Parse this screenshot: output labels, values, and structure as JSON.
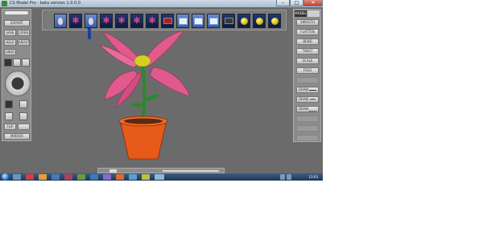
{
  "window": {
    "title": "CS Model Pro - beta version 1.0.0.0",
    "controls": {
      "minimize": "–",
      "maximize": "□",
      "close": "✕"
    }
  },
  "left_panel": {
    "top_slider_label": "",
    "buttons": [
      {
        "label": "EXPORT"
      },
      {
        "label": "SAVE"
      },
      {
        "label": "OPEN"
      },
      {
        "label": "HELP"
      },
      {
        "label": "ABOUT"
      },
      {
        "label": "UNDO"
      }
    ],
    "bottom_button": "MIRROR",
    "flip_button": "FLIP"
  },
  "toolbar": {
    "tools": [
      {
        "name": "egg-shape"
      },
      {
        "name": "flower-shape"
      },
      {
        "name": "egg-shape"
      },
      {
        "name": "flower-shape"
      },
      {
        "name": "flower-shape"
      },
      {
        "name": "flower-shape"
      },
      {
        "name": "flower-shape"
      },
      {
        "name": "dark-panel"
      },
      {
        "name": "grid-panel"
      },
      {
        "name": "grid-panel"
      },
      {
        "name": "grid-panel"
      },
      {
        "name": "dark-panel"
      },
      {
        "name": "sphere"
      },
      {
        "name": "sphere"
      },
      {
        "name": "sphere"
      }
    ]
  },
  "right_panel": {
    "tabs": {
      "active": "MODEL",
      "other": ""
    },
    "buttons": [
      "SMOOTH",
      "FLATTEN",
      "BEND",
      "TWIST",
      "SCALE",
      "FOLD"
    ],
    "draw_buttons": [
      "DRAW",
      "DRAW",
      "DRAW"
    ]
  },
  "taskbar": {
    "clock": "13:03"
  },
  "colors": {
    "viewport_bg": "#6b6b6b",
    "petal": "#e05a8e",
    "pot": "#e85a1a",
    "stem": "#2a8a2a",
    "center": "#d8d020"
  }
}
